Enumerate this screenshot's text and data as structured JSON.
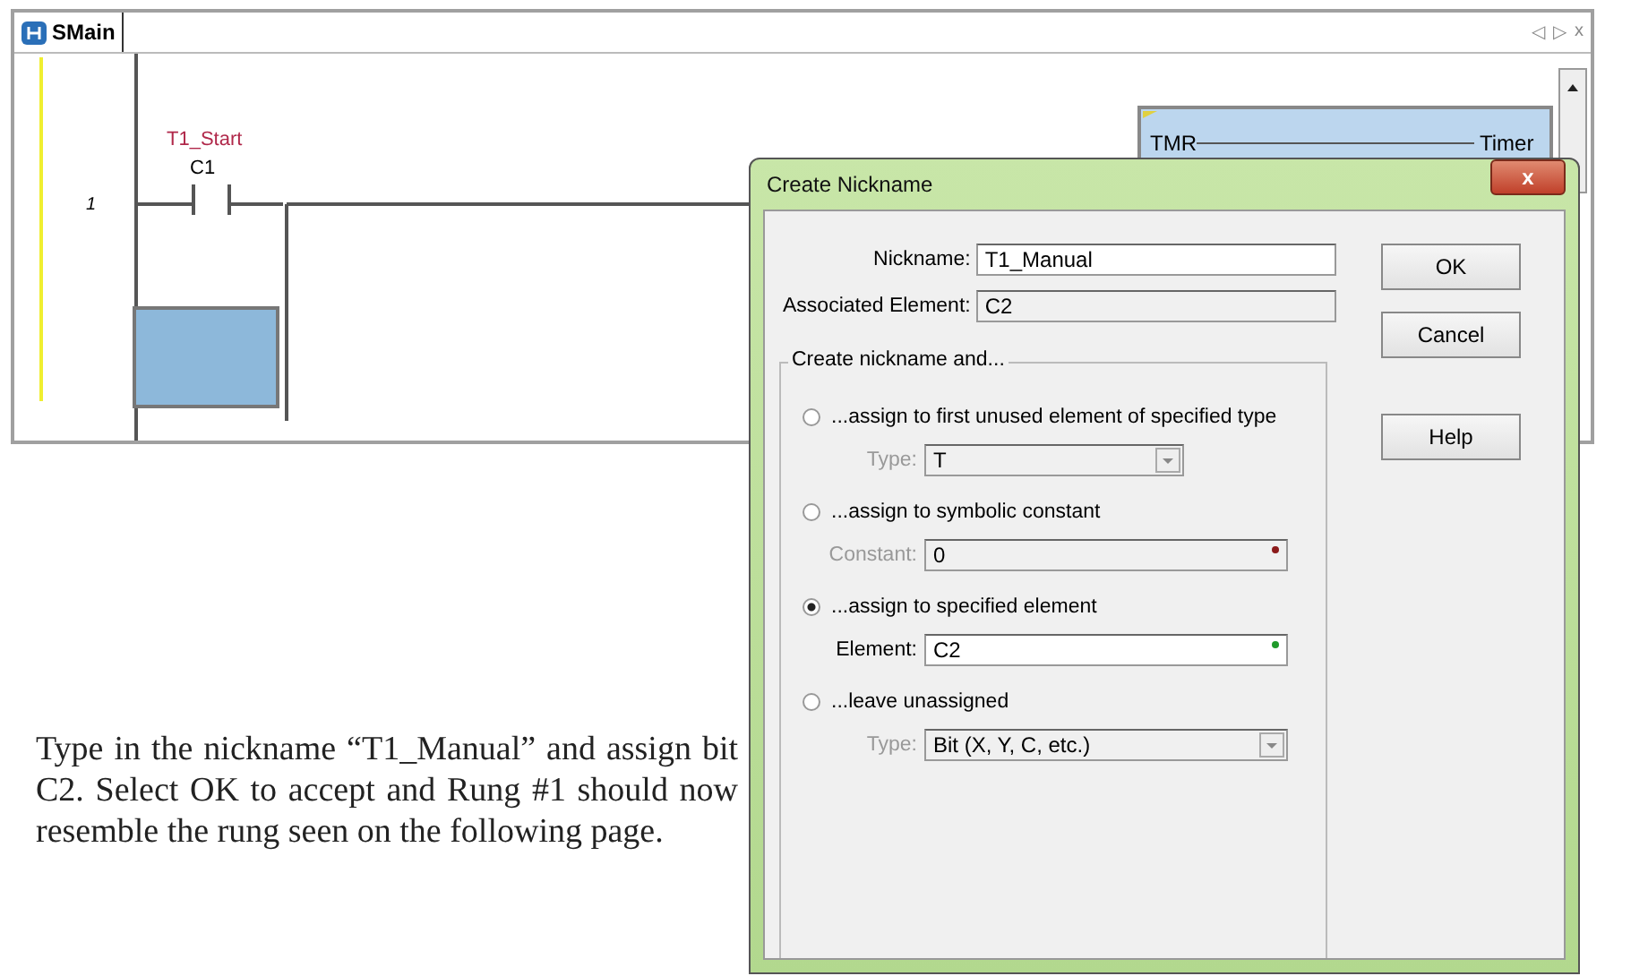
{
  "editor": {
    "tab": {
      "label": "SMain"
    },
    "nav_buttons": [
      "◁",
      "▷",
      "x"
    ],
    "rung": {
      "number": "1",
      "contact": {
        "nickname": "T1_Start",
        "address": "C1"
      },
      "timer": {
        "label": "TMR",
        "title": "Timer"
      }
    }
  },
  "dialog": {
    "title": "Create Nickname",
    "close": "x",
    "fields": [
      {
        "label": "Nickname:",
        "value": "T1_Manual",
        "disabled": false
      },
      {
        "label": "Associated Element:",
        "value": "C2",
        "disabled": true
      }
    ],
    "buttons": [
      "OK",
      "Cancel",
      "Help"
    ],
    "group": {
      "title": "Create nickname and...",
      "options": [
        {
          "label": "...assign to first unused element of specified type",
          "selected": false,
          "field": {
            "kind": "dropdown",
            "label": "Type:",
            "value": "T",
            "disabled": true
          }
        },
        {
          "label": "...assign to symbolic constant",
          "selected": false,
          "field": {
            "kind": "text",
            "label": "Constant:",
            "value": "0",
            "disabled": true,
            "color": "#8b1a1a"
          }
        },
        {
          "label": "...assign to specified element",
          "selected": true,
          "field": {
            "kind": "text",
            "label": "Element:",
            "value": "C2",
            "disabled": false,
            "color": "#1f9a2a"
          }
        },
        {
          "label": "...leave unassigned",
          "selected": false,
          "field": {
            "kind": "dropdown",
            "label": "Type:",
            "value": "Bit (X, Y, C, etc.)",
            "disabled": true
          }
        }
      ]
    }
  },
  "paragraph": "Type in the nickname “T1_Manual” and assign bit C2.  Select OK to accept and Rung #1 should now resemble the rung seen on the following page."
}
